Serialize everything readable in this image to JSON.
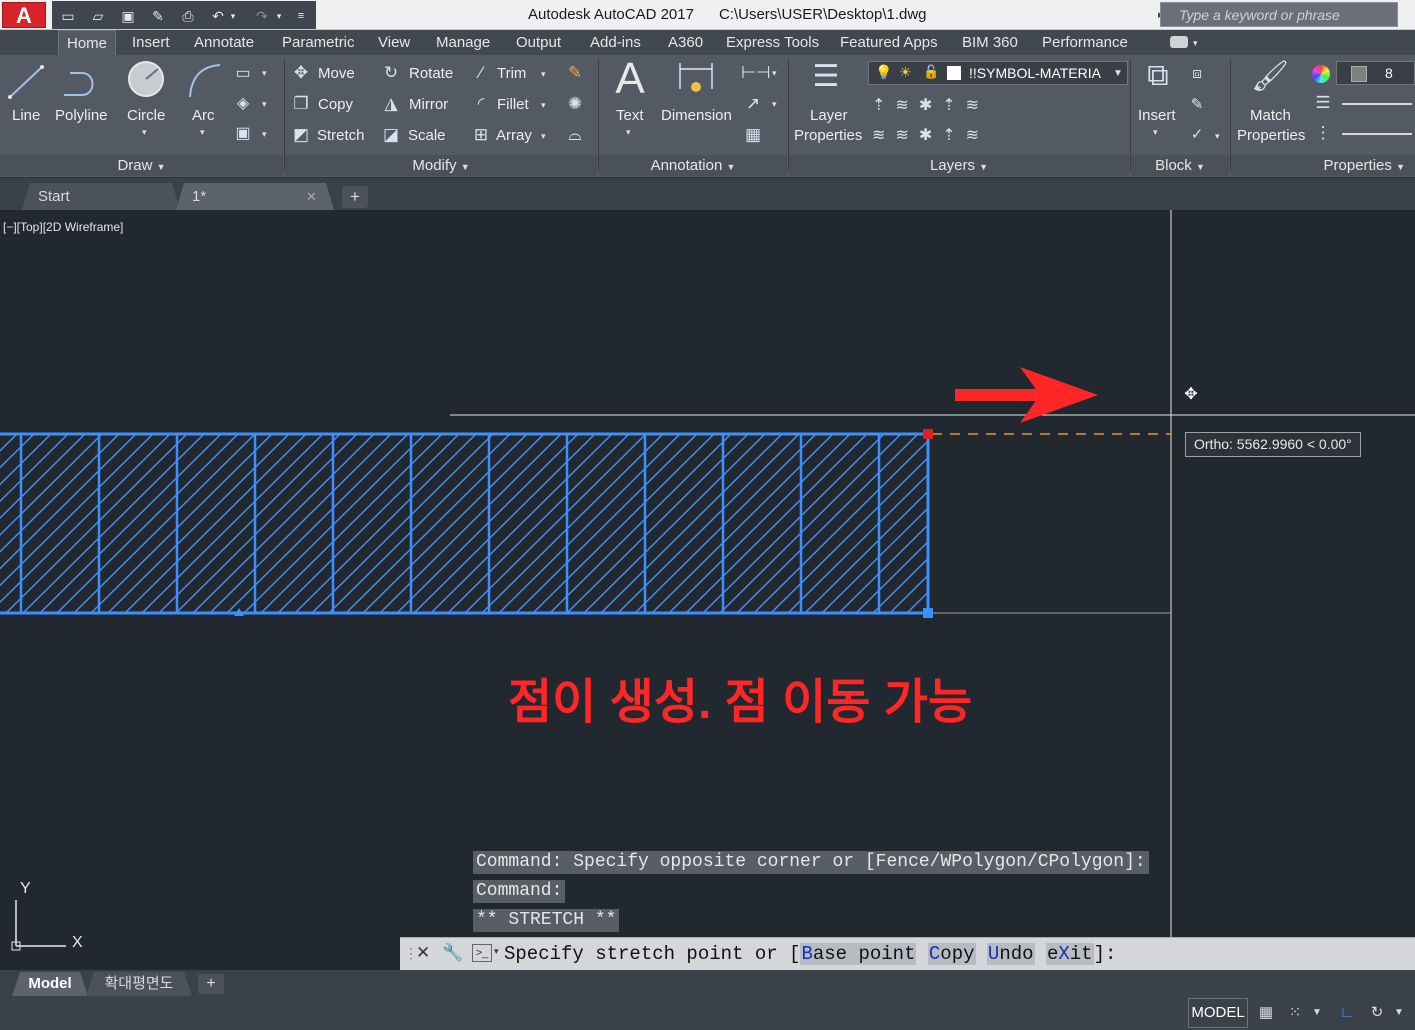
{
  "app": {
    "logo": "A",
    "title": "Autodesk AutoCAD 2017      C:\\Users\\USER\\Desktop\\1.dwg",
    "search_placeholder": "Type a keyword or phrase"
  },
  "ribbon_tabs": [
    "Home",
    "Insert",
    "Annotate",
    "Parametric",
    "View",
    "Manage",
    "Output",
    "Add-ins",
    "A360",
    "Express Tools",
    "Featured Apps",
    "BIM 360",
    "Performance"
  ],
  "ribbon": {
    "draw": {
      "title": "Draw",
      "line": "Line",
      "polyline": "Polyline",
      "circle": "Circle",
      "arc": "Arc"
    },
    "modify": {
      "title": "Modify",
      "move": "Move",
      "rotate": "Rotate",
      "trim": "Trim",
      "copy": "Copy",
      "mirror": "Mirror",
      "fillet": "Fillet",
      "stretch": "Stretch",
      "scale": "Scale",
      "array": "Array"
    },
    "annotation": {
      "title": "Annotation",
      "text": "Text",
      "dimension": "Dimension"
    },
    "layers": {
      "title": "Layers",
      "layer_properties_1": "Layer",
      "layer_properties_2": "Properties",
      "current_layer": "!!SYMBOL-MATERIA"
    },
    "block": {
      "title": "Block",
      "insert": "Insert"
    },
    "properties": {
      "title": "Properties",
      "match_1": "Match",
      "match_2": "Properties",
      "color_value": "8"
    }
  },
  "doc_tabs": {
    "start": "Start",
    "current": "1*"
  },
  "viewport": {
    "label": "[−][Top][2D Wireframe]",
    "annotation_text": "점이 생성. 점 이동 가능",
    "ortho_tip": "Ortho: 5562.9960 < 0.00°",
    "ucs_x": "X",
    "ucs_y": "Y"
  },
  "command": {
    "history": [
      "Command: Specify opposite corner or [Fence/WPolygon/CPolygon]:",
      "Command:",
      "** STRETCH **"
    ],
    "prompt_prefix": "Specify stretch point or [",
    "options": [
      {
        "hl": "B",
        "rest": "ase point"
      },
      {
        "hl": "C",
        "rest": "opy"
      },
      {
        "hl": "U",
        "rest": "ndo"
      },
      {
        "pre": "e",
        "hl": "X",
        "rest": "it"
      }
    ],
    "prompt_suffix": "]:"
  },
  "layout_tabs": [
    "Model",
    "확대평면도"
  ],
  "status": {
    "model": "MODEL"
  },
  "colors": {
    "accent_red": "#ff2626",
    "selection_blue": "#3b8fff",
    "ribbon_bg": "#535a63",
    "canvas_bg": "#212830"
  }
}
